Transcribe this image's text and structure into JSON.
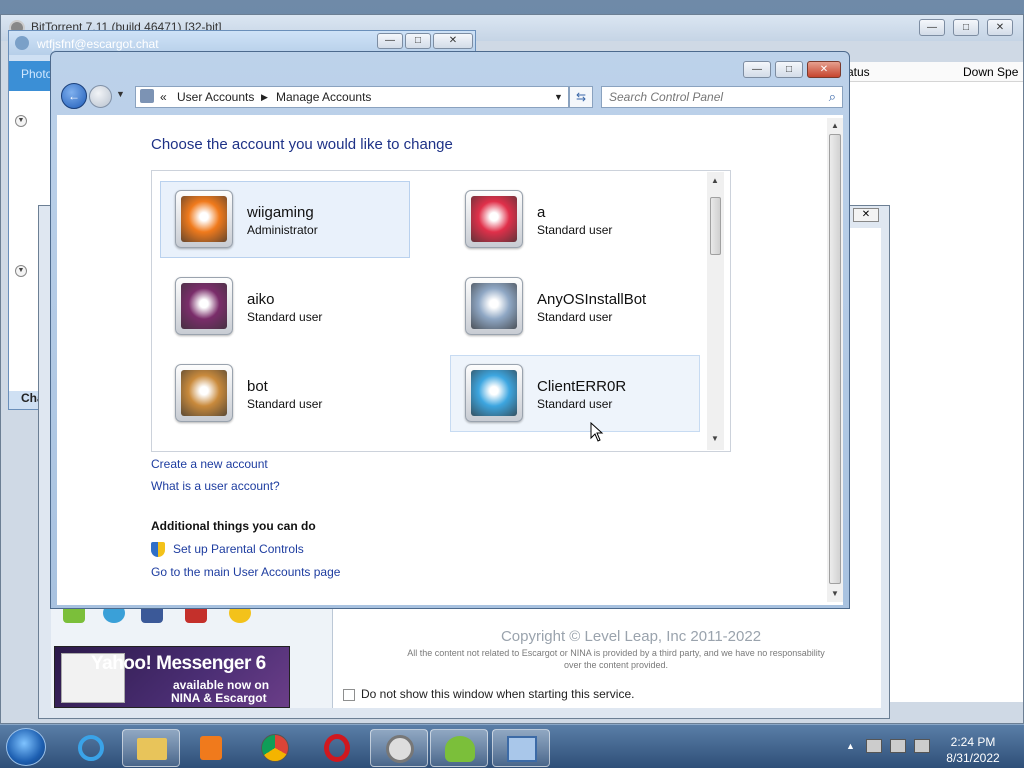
{
  "bittorrent": {
    "title": "BitTorrent 7.11  (build 46471) [32-bit]",
    "col_status": "atus",
    "col_down": "Down Spe"
  },
  "escargot": {
    "title": "wtfjsfnf@escargot.chat",
    "tab": "Photo",
    "chat_label": "Chat"
  },
  "nina": {
    "copyright": "Copyright © Level Leap, Inc 2011-2022",
    "disclaimer_line1": "All the content not related to Escargot or NINA is provided by a third party, and we have no responsability",
    "disclaimer_line2": "over the content provided.",
    "dont_show": "Do not show this window when starting this service.",
    "ad_headline": "Yahoo! Messenger 6",
    "ad_line1": "available now on",
    "ad_line2": "NINA & Escargot"
  },
  "control_panel": {
    "breadcrumb": {
      "overflow": "«",
      "root": "User Accounts",
      "page": "Manage Accounts"
    },
    "search_placeholder": "Search Control Panel",
    "heading": "Choose the account you would like to change",
    "accounts": [
      {
        "name": "wiigaming",
        "role": "Administrator",
        "pic": "orange-flower",
        "color": "#f07a1c"
      },
      {
        "name": "a",
        "role": "Standard user",
        "pic": "red-star",
        "color": "#e0304a"
      },
      {
        "name": "aiko",
        "role": "Standard user",
        "pic": "purple-ball",
        "color": "#7a2d6a"
      },
      {
        "name": "AnyOSInstallBot",
        "role": "Standard user",
        "pic": "robot",
        "color": "#8fa7c4"
      },
      {
        "name": "bot",
        "role": "Standard user",
        "pic": "puppy",
        "color": "#c98a3c"
      },
      {
        "name": "ClientERR0R",
        "role": "Standard user",
        "pic": "pinwheel",
        "color": "#3da6e0"
      }
    ],
    "links": {
      "create": "Create a new account",
      "what_is": "What is a user account?",
      "parental": "Set up Parental Controls",
      "main_page": "Go to the main User Accounts page"
    },
    "additional_heading": "Additional things you can do"
  },
  "taskbar": {
    "time": "2:24 PM",
    "date": "8/31/2022"
  }
}
